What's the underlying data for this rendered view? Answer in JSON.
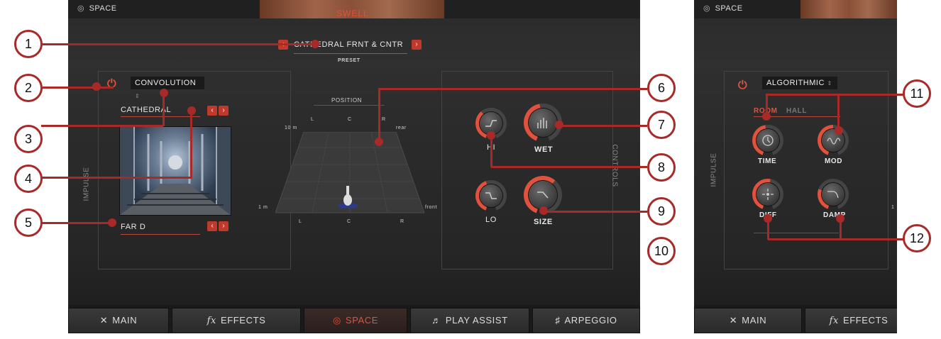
{
  "left": {
    "top_tag": "SPACE",
    "swell": "SWELL",
    "preset_name": "CATHEDRAL FRNT & CNTR",
    "preset_label": "PRESET",
    "mode": "CONVOLUTION",
    "ir_category": "CATHEDRAL",
    "ir_name": "FAR D",
    "impulse_label": "IMPULSE",
    "controls_label": "CONTROLS",
    "position": {
      "title": "POSITION",
      "top_labels": [
        "L",
        "C",
        "R"
      ],
      "bottom_labels": [
        "L",
        "C",
        "R"
      ],
      "distance_far": "10 m",
      "distance_near": "1 m",
      "rear": "rear",
      "front": "front"
    },
    "knobs": {
      "hi": "HI",
      "wet": "WET",
      "lo": "LO",
      "size": "SIZE"
    }
  },
  "right": {
    "top_tag": "SPACE",
    "mode": "ALGORITHMIC",
    "room": "ROOM",
    "hall": "HALL",
    "impulse_label": "IMPULSE",
    "edge_label": "1",
    "knobs": {
      "time": "TIME",
      "mod": "MOD",
      "diff": "DIFF",
      "damp": "DAMP"
    }
  },
  "tabs": {
    "main": "MAIN",
    "effects": "EFFECTS",
    "space": "SPACE",
    "play_assist": "PLAY ASSIST",
    "arpeggio": "ARPEGGIO"
  },
  "callouts": [
    "1",
    "2",
    "3",
    "4",
    "5",
    "6",
    "7",
    "8",
    "9",
    "10",
    "11",
    "12"
  ],
  "colors": {
    "accent": "#e0523e",
    "callout": "#a82a28",
    "panel": "#2a2a2a"
  }
}
